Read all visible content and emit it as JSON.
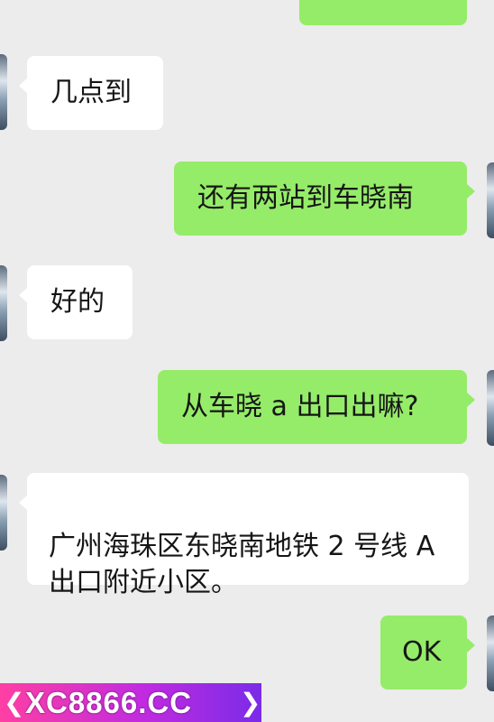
{
  "messages": [
    {
      "side": "left",
      "text": "几点到"
    },
    {
      "side": "right",
      "text": "还有两站到车晓南"
    },
    {
      "side": "left",
      "text": "好的"
    },
    {
      "side": "right",
      "text": "从车晓 a 出口出嘛?"
    },
    {
      "side": "left",
      "text": "广州海珠区东晓南地铁 2 号线 A\n出口附近小区。"
    },
    {
      "side": "right",
      "text": "OK"
    }
  ],
  "watermark": {
    "text": "XC8866.CC"
  },
  "colors": {
    "outgoing": "#95ec69",
    "incoming": "#ffffff",
    "background": "#ececec",
    "watermark": "#ff3fa4"
  }
}
